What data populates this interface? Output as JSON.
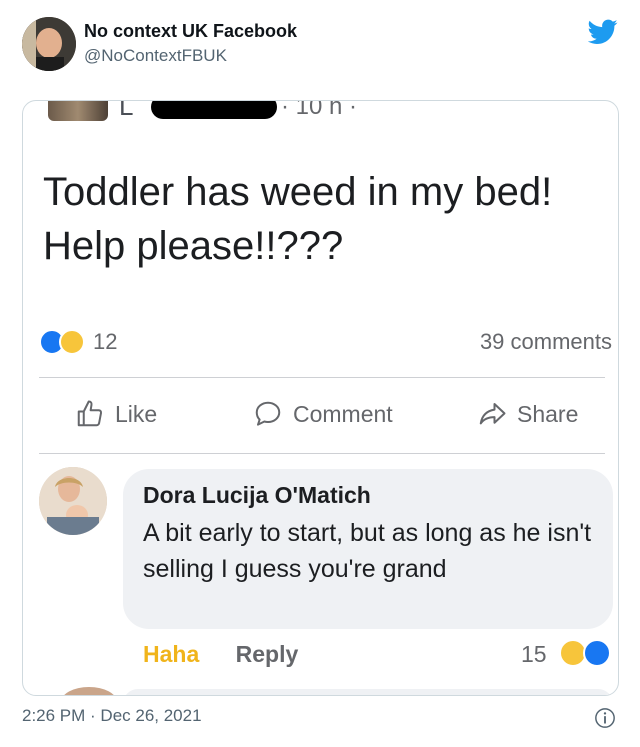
{
  "tweet": {
    "author_name": "No context UK Facebook",
    "author_handle": "@NoContextFBUK",
    "timestamp": "2:26 PM · Dec 26, 2021",
    "brand_color": "#1d9bf0"
  },
  "fb_post": {
    "name_fragment": "L",
    "time": "· 10 h ·",
    "text": "Toddler has weed in my bed! Help please!!???",
    "reaction_count": "12",
    "comments_count": "39 comments",
    "actions": {
      "like": "Like",
      "comment": "Comment",
      "share": "Share"
    }
  },
  "comment": {
    "author": "Dora Lucija O'Matich",
    "text": "A bit early to start, but as long as he isn't selling I guess you're grand",
    "haha_label": "Haha",
    "reply_label": "Reply",
    "reaction_count": "15"
  }
}
